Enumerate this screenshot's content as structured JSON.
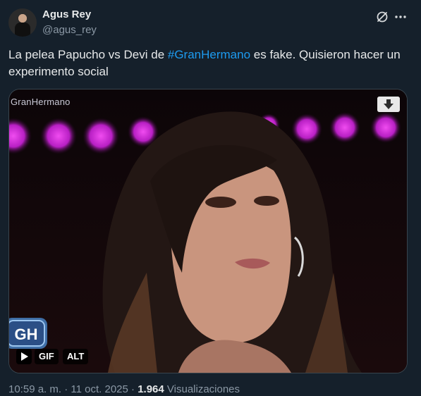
{
  "author": {
    "display_name": "Agus Rey",
    "handle": "@agus_rey",
    "avatar_icon": "profile-photo"
  },
  "header_icons": [
    "grok-icon",
    "more-icon"
  ],
  "tweet": {
    "text_before": "La pelea Papucho vs Devi de ",
    "hashtag": "#GranHermano",
    "text_after": " es fake. Quisieron hacer un experimento social"
  },
  "media": {
    "type": "gif",
    "watermark_text": "GranHermano",
    "logo_text": "GH",
    "badges": {
      "play_icon": "play-icon",
      "gif_label": "GIF",
      "alt_label": "ALT"
    },
    "download_icon": "download-icon"
  },
  "meta": {
    "time": "10:59 a. m.",
    "separator": "·",
    "date": "11 oct. 2025",
    "views_count": "1.964",
    "views_label": "Visualizaciones"
  },
  "colors": {
    "background": "#15202b",
    "text_primary": "#e7e9ea",
    "text_secondary": "#8b98a5",
    "link": "#1d9bf0",
    "border": "#38444d"
  }
}
